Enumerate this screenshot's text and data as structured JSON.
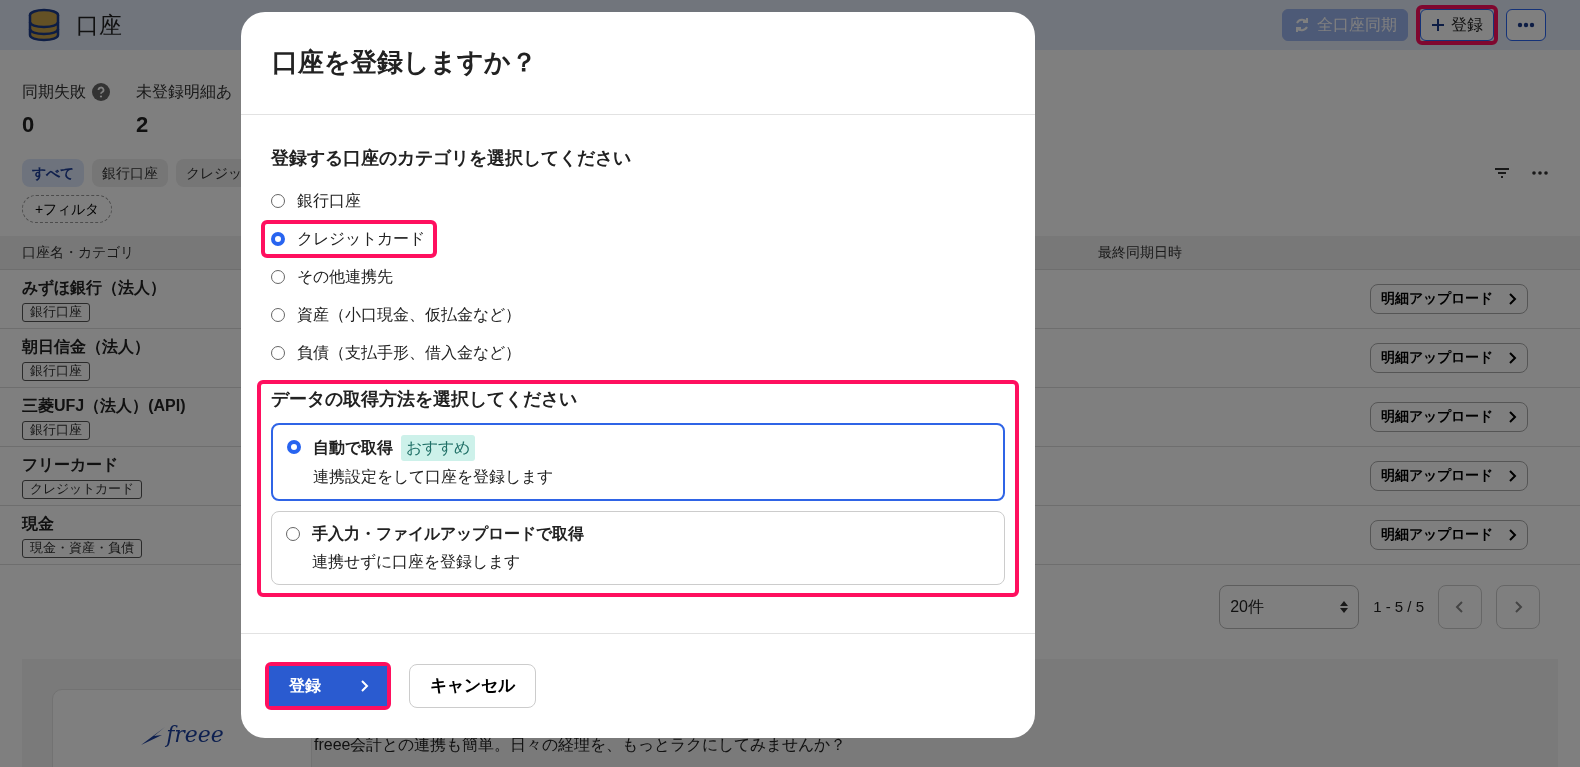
{
  "page": {
    "title": "口座",
    "actions": [
      {
        "kind": "sync",
        "label": "全口座同期",
        "disabled": true,
        "highlighted": false
      },
      {
        "kind": "add",
        "label": "登録",
        "disabled": false,
        "highlighted": true
      },
      {
        "kind": "more",
        "disabled": false,
        "highlighted": false
      }
    ]
  },
  "stats": [
    {
      "label": "同期失敗",
      "value": "0",
      "help": true
    },
    {
      "label": "未登録明細あ",
      "value": "2",
      "help": false
    }
  ],
  "filter_chips": [
    {
      "label": "すべて",
      "selected": true
    },
    {
      "label": "銀行口座",
      "selected": false
    },
    {
      "label": "クレジッ",
      "selected": false
    }
  ],
  "add_filter": "+フィルタ",
  "table": {
    "columns": [
      "口座名・カテゴリ",
      "最終同期日時"
    ],
    "rows": [
      {
        "name": "みずほ銀行（法人）",
        "category": "銀行口座",
        "action": "明細アップロード"
      },
      {
        "name": "朝日信金（法人）",
        "category": "銀行口座",
        "action": "明細アップロード"
      },
      {
        "name": "三菱UFJ（法人）(API)",
        "category": "銀行口座",
        "action": "明細アップロード"
      },
      {
        "name": "フリーカード",
        "category": "クレジットカード",
        "action": "明細アップロード"
      },
      {
        "name": "現金",
        "category": "現金・資産・負債",
        "action": "明細アップロード"
      }
    ]
  },
  "pagination": {
    "page_size": "20件",
    "range": "1 - 5 / 5"
  },
  "promo": {
    "logo": "freee",
    "text": "freee会計との連携も簡単。日々の経理を、もっとラクにしてみませんか？"
  },
  "dialog": {
    "title": "口座を登録しますか？",
    "category_prompt": "登録する口座のカテゴリを選択してください",
    "categories": [
      {
        "label": "銀行口座",
        "selected": false,
        "highlighted": false
      },
      {
        "label": "クレジットカード",
        "selected": true,
        "highlighted": true
      },
      {
        "label": "その他連携先",
        "selected": false,
        "highlighted": false
      },
      {
        "label": "資産（小口現金、仮払金など）",
        "selected": false,
        "highlighted": false
      },
      {
        "label": "負債（支払手形、借入金など）",
        "selected": false,
        "highlighted": false
      }
    ],
    "methods_highlighted": true,
    "method_prompt": "データの取得方法を選択してください",
    "methods": [
      {
        "label": "自動で取得",
        "badge": "おすすめ",
        "description": "連携設定をして口座を登録します",
        "selected": true
      },
      {
        "label": "手入力・ファイルアップロードで取得",
        "description": "連携せずに口座を登録します",
        "selected": false
      }
    ],
    "buttons": [
      {
        "kind": "primary",
        "label": "登録",
        "highlighted": true
      },
      {
        "kind": "secondary",
        "label": "キャンセル",
        "highlighted": false
      }
    ]
  }
}
